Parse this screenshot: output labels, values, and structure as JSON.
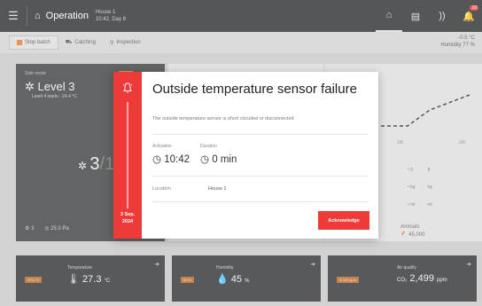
{
  "topbar": {
    "section": "Operation",
    "house": "House 1",
    "day": "10:42, Day 8",
    "notification_count": "19"
  },
  "toolbar": {
    "stop_label": "Stop batch",
    "catching_label": "Catching",
    "inspection_label": "Inspection",
    "outside_temp": "-0.5 °C",
    "outside_humidity": "Humidity 77 %"
  },
  "level_card": {
    "mode": "Side mode",
    "level": "Level 3",
    "sub": "Level 4 starts - 24.4 °C",
    "fans_on": "3",
    "fans_total": "/12",
    "foot_count": "3",
    "foot_pressure": "25.0 Pa"
  },
  "graph_card": {
    "x_label_1": "2/8",
    "x_label_2": "3/8",
    "row1_a": "g",
    "row1_b": "g",
    "row2_a": "kg",
    "row2_b": "kg",
    "row3_a": "ml",
    "row3_b": "ml",
    "animals_label": "Animals",
    "animals_value": "45,000"
  },
  "bottom": {
    "temperature_label": "Temperature",
    "temperature_tag": "25.5 °C",
    "temperature_value": "27.3",
    "temperature_unit": "°C",
    "humidity_label": "Humidity",
    "humidity_tag": "60 %",
    "humidity_value": "45",
    "humidity_unit": "%",
    "air_label": "Air quality",
    "air_tag": "3,000 ppm",
    "air_prefix": "CO₂",
    "air_value": "2,499",
    "air_unit": "ppm"
  },
  "alarm": {
    "title": "Outside temperature sensor failure",
    "description": "The outside temperature sensor is short circuited or disconnected",
    "activation_label": "Activation",
    "activation_value": "10:42",
    "duration_label": "Duration",
    "duration_value": "0 min",
    "location_label": "Location",
    "location_value": "House 1",
    "date_line1": "3 Sep.",
    "date_line2": "2024",
    "acknowledge_label": "Acknowledge",
    "accent_color": "#ef3a3a"
  }
}
